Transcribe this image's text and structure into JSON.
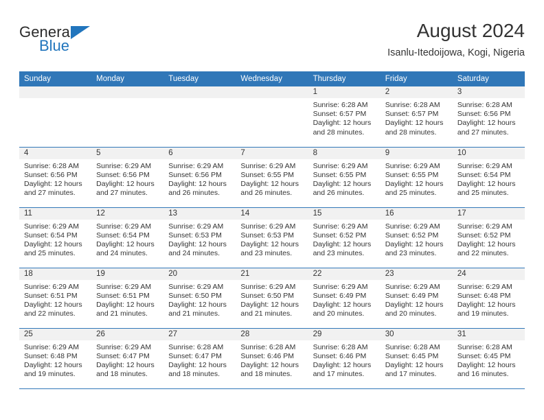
{
  "brand": {
    "name_part1": "General",
    "name_part2": "Blue"
  },
  "header": {
    "title": "August 2024",
    "subtitle": "Isanlu-Itedoijowa, Kogi, Nigeria",
    "accent_color": "#3077b8",
    "band_color": "#f1f1f1"
  },
  "weekdays": [
    "Sunday",
    "Monday",
    "Tuesday",
    "Wednesday",
    "Thursday",
    "Friday",
    "Saturday"
  ],
  "labels": {
    "sunrise_prefix": "Sunrise: ",
    "sunset_prefix": "Sunset: ",
    "daylight_prefix": "Daylight: "
  },
  "weeks": [
    [
      {
        "day": "",
        "empty": true
      },
      {
        "day": "",
        "empty": true
      },
      {
        "day": "",
        "empty": true
      },
      {
        "day": "",
        "empty": true
      },
      {
        "day": "1",
        "sunrise": "Sunrise: 6:28 AM",
        "sunset": "Sunset: 6:57 PM",
        "daylight_line1": "Daylight: 12 hours",
        "daylight_line2": "and 28 minutes."
      },
      {
        "day": "2",
        "sunrise": "Sunrise: 6:28 AM",
        "sunset": "Sunset: 6:57 PM",
        "daylight_line1": "Daylight: 12 hours",
        "daylight_line2": "and 28 minutes."
      },
      {
        "day": "3",
        "sunrise": "Sunrise: 6:28 AM",
        "sunset": "Sunset: 6:56 PM",
        "daylight_line1": "Daylight: 12 hours",
        "daylight_line2": "and 27 minutes."
      }
    ],
    [
      {
        "day": "4",
        "sunrise": "Sunrise: 6:28 AM",
        "sunset": "Sunset: 6:56 PM",
        "daylight_line1": "Daylight: 12 hours",
        "daylight_line2": "and 27 minutes."
      },
      {
        "day": "5",
        "sunrise": "Sunrise: 6:29 AM",
        "sunset": "Sunset: 6:56 PM",
        "daylight_line1": "Daylight: 12 hours",
        "daylight_line2": "and 27 minutes."
      },
      {
        "day": "6",
        "sunrise": "Sunrise: 6:29 AM",
        "sunset": "Sunset: 6:56 PM",
        "daylight_line1": "Daylight: 12 hours",
        "daylight_line2": "and 26 minutes."
      },
      {
        "day": "7",
        "sunrise": "Sunrise: 6:29 AM",
        "sunset": "Sunset: 6:55 PM",
        "daylight_line1": "Daylight: 12 hours",
        "daylight_line2": "and 26 minutes."
      },
      {
        "day": "8",
        "sunrise": "Sunrise: 6:29 AM",
        "sunset": "Sunset: 6:55 PM",
        "daylight_line1": "Daylight: 12 hours",
        "daylight_line2": "and 26 minutes."
      },
      {
        "day": "9",
        "sunrise": "Sunrise: 6:29 AM",
        "sunset": "Sunset: 6:55 PM",
        "daylight_line1": "Daylight: 12 hours",
        "daylight_line2": "and 25 minutes."
      },
      {
        "day": "10",
        "sunrise": "Sunrise: 6:29 AM",
        "sunset": "Sunset: 6:54 PM",
        "daylight_line1": "Daylight: 12 hours",
        "daylight_line2": "and 25 minutes."
      }
    ],
    [
      {
        "day": "11",
        "sunrise": "Sunrise: 6:29 AM",
        "sunset": "Sunset: 6:54 PM",
        "daylight_line1": "Daylight: 12 hours",
        "daylight_line2": "and 25 minutes."
      },
      {
        "day": "12",
        "sunrise": "Sunrise: 6:29 AM",
        "sunset": "Sunset: 6:54 PM",
        "daylight_line1": "Daylight: 12 hours",
        "daylight_line2": "and 24 minutes."
      },
      {
        "day": "13",
        "sunrise": "Sunrise: 6:29 AM",
        "sunset": "Sunset: 6:53 PM",
        "daylight_line1": "Daylight: 12 hours",
        "daylight_line2": "and 24 minutes."
      },
      {
        "day": "14",
        "sunrise": "Sunrise: 6:29 AM",
        "sunset": "Sunset: 6:53 PM",
        "daylight_line1": "Daylight: 12 hours",
        "daylight_line2": "and 23 minutes."
      },
      {
        "day": "15",
        "sunrise": "Sunrise: 6:29 AM",
        "sunset": "Sunset: 6:52 PM",
        "daylight_line1": "Daylight: 12 hours",
        "daylight_line2": "and 23 minutes."
      },
      {
        "day": "16",
        "sunrise": "Sunrise: 6:29 AM",
        "sunset": "Sunset: 6:52 PM",
        "daylight_line1": "Daylight: 12 hours",
        "daylight_line2": "and 23 minutes."
      },
      {
        "day": "17",
        "sunrise": "Sunrise: 6:29 AM",
        "sunset": "Sunset: 6:52 PM",
        "daylight_line1": "Daylight: 12 hours",
        "daylight_line2": "and 22 minutes."
      }
    ],
    [
      {
        "day": "18",
        "sunrise": "Sunrise: 6:29 AM",
        "sunset": "Sunset: 6:51 PM",
        "daylight_line1": "Daylight: 12 hours",
        "daylight_line2": "and 22 minutes."
      },
      {
        "day": "19",
        "sunrise": "Sunrise: 6:29 AM",
        "sunset": "Sunset: 6:51 PM",
        "daylight_line1": "Daylight: 12 hours",
        "daylight_line2": "and 21 minutes."
      },
      {
        "day": "20",
        "sunrise": "Sunrise: 6:29 AM",
        "sunset": "Sunset: 6:50 PM",
        "daylight_line1": "Daylight: 12 hours",
        "daylight_line2": "and 21 minutes."
      },
      {
        "day": "21",
        "sunrise": "Sunrise: 6:29 AM",
        "sunset": "Sunset: 6:50 PM",
        "daylight_line1": "Daylight: 12 hours",
        "daylight_line2": "and 21 minutes."
      },
      {
        "day": "22",
        "sunrise": "Sunrise: 6:29 AM",
        "sunset": "Sunset: 6:49 PM",
        "daylight_line1": "Daylight: 12 hours",
        "daylight_line2": "and 20 minutes."
      },
      {
        "day": "23",
        "sunrise": "Sunrise: 6:29 AM",
        "sunset": "Sunset: 6:49 PM",
        "daylight_line1": "Daylight: 12 hours",
        "daylight_line2": "and 20 minutes."
      },
      {
        "day": "24",
        "sunrise": "Sunrise: 6:29 AM",
        "sunset": "Sunset: 6:48 PM",
        "daylight_line1": "Daylight: 12 hours",
        "daylight_line2": "and 19 minutes."
      }
    ],
    [
      {
        "day": "25",
        "sunrise": "Sunrise: 6:29 AM",
        "sunset": "Sunset: 6:48 PM",
        "daylight_line1": "Daylight: 12 hours",
        "daylight_line2": "and 19 minutes."
      },
      {
        "day": "26",
        "sunrise": "Sunrise: 6:29 AM",
        "sunset": "Sunset: 6:47 PM",
        "daylight_line1": "Daylight: 12 hours",
        "daylight_line2": "and 18 minutes."
      },
      {
        "day": "27",
        "sunrise": "Sunrise: 6:28 AM",
        "sunset": "Sunset: 6:47 PM",
        "daylight_line1": "Daylight: 12 hours",
        "daylight_line2": "and 18 minutes."
      },
      {
        "day": "28",
        "sunrise": "Sunrise: 6:28 AM",
        "sunset": "Sunset: 6:46 PM",
        "daylight_line1": "Daylight: 12 hours",
        "daylight_line2": "and 18 minutes."
      },
      {
        "day": "29",
        "sunrise": "Sunrise: 6:28 AM",
        "sunset": "Sunset: 6:46 PM",
        "daylight_line1": "Daylight: 12 hours",
        "daylight_line2": "and 17 minutes."
      },
      {
        "day": "30",
        "sunrise": "Sunrise: 6:28 AM",
        "sunset": "Sunset: 6:45 PM",
        "daylight_line1": "Daylight: 12 hours",
        "daylight_line2": "and 17 minutes."
      },
      {
        "day": "31",
        "sunrise": "Sunrise: 6:28 AM",
        "sunset": "Sunset: 6:45 PM",
        "daylight_line1": "Daylight: 12 hours",
        "daylight_line2": "and 16 minutes."
      }
    ]
  ]
}
